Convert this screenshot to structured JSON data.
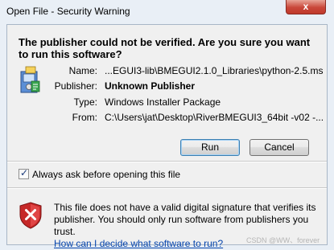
{
  "window": {
    "title": "Open File - Security Warning",
    "close_label": "x"
  },
  "headline": "The publisher could not be verified.  Are you sure you want to run this software?",
  "details": {
    "name_label": "Name:",
    "name_value": "...EGUI3-lib\\BMEGUI2.1.0_Libraries\\python-2.5.msi",
    "publisher_label": "Publisher:",
    "publisher_value": "Unknown Publisher",
    "type_label": "Type:",
    "type_value": "Windows Installer Package",
    "from_label": "From:",
    "from_value": "C:\\Users\\jat\\Desktop\\RiverBMEGUI3_64bit -v02 -..."
  },
  "buttons": {
    "run": "Run",
    "cancel": "Cancel"
  },
  "checkbox": {
    "label": "Always ask before opening this file",
    "checked": true
  },
  "warning": {
    "text": "This file does not have a valid digital signature that verifies its publisher.  You should only run software from publishers you trust.",
    "link": "How can I decide what software to run?"
  },
  "icons": {
    "installer": "installer-package-icon",
    "shield": "security-shield-error-icon"
  },
  "watermark": "CSDN @WW、forever"
}
